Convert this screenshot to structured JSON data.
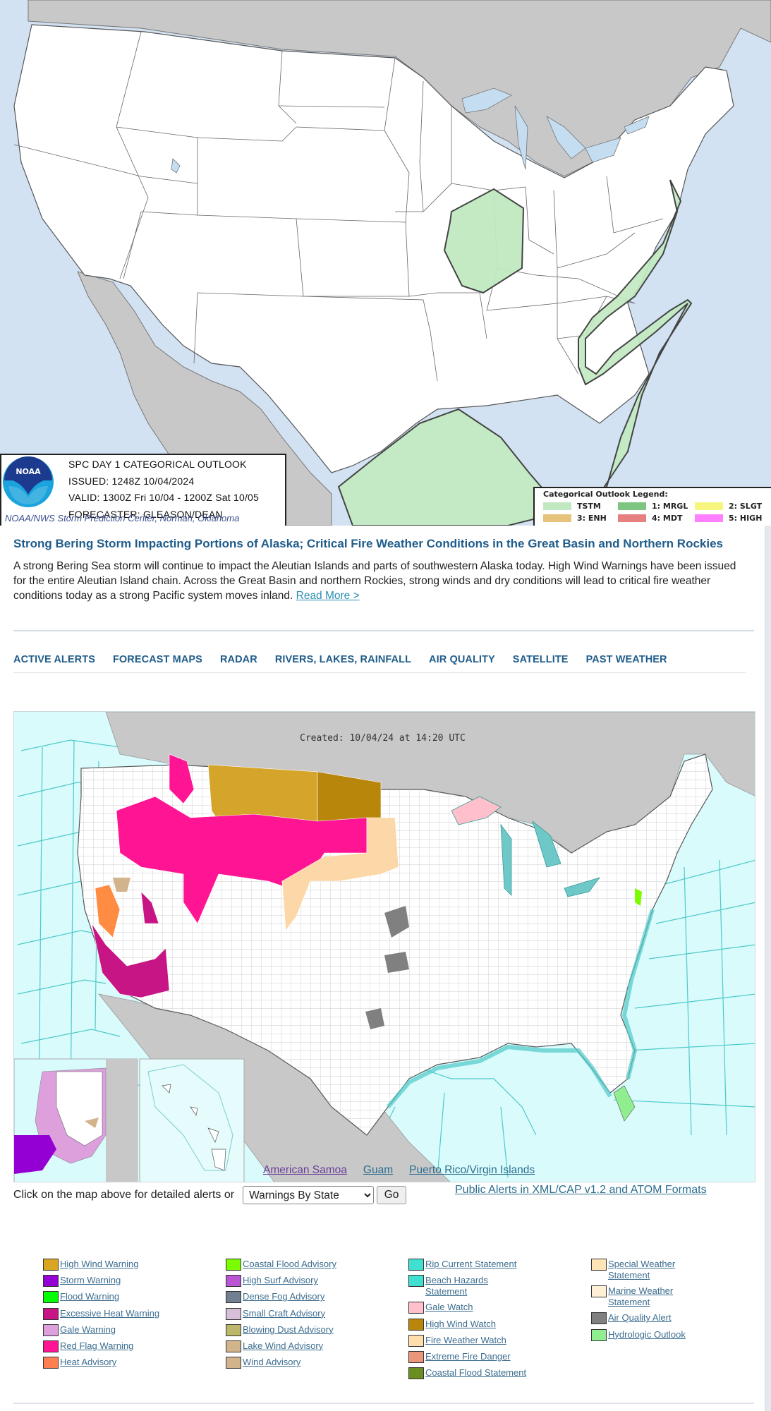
{
  "spc_outlook": {
    "title": "SPC DAY 1 CATEGORICAL OUTLOOK",
    "issued": "ISSUED: 1248Z 10/04/2024",
    "valid": "VALID: 1300Z Fri 10/04 - 1200Z Sat 10/05",
    "forecaster": "FORECASTER: GLEASON/DEAN",
    "credit": "NOAA/NWS Storm Prediction Center, Norman, Oklahoma",
    "logo_text": "NOAA",
    "legend": {
      "title": "Categorical Outlook Legend:",
      "items": [
        {
          "label": "TSTM",
          "color": "#c1e9c1"
        },
        {
          "label": "1: MRGL",
          "color": "#7dc580"
        },
        {
          "label": "2: SLGT",
          "color": "#f6f67f"
        },
        {
          "label": "3: ENH",
          "color": "#e6c27a"
        },
        {
          "label": "4: MDT",
          "color": "#e67f7f"
        },
        {
          "label": "5: HIGH",
          "color": "#ff7fff"
        }
      ]
    },
    "active_category": "TSTM"
  },
  "headline": {
    "title": "Strong Bering Storm Impacting Portions of Alaska; Critical Fire Weather Conditions in the Great Basin and Northern Rockies",
    "body": "A strong Bering Sea storm will continue to impact the Aleutian Islands and parts of southwestern Alaska today. High Wind Warnings have been issued for the entire Aleutian Island chain. Across the Great Basin and northern Rockies, strong winds and dry conditions will lead to critical fire weather conditions today as a strong Pacific system moves inland.",
    "read_more": "Read More >"
  },
  "nav": {
    "items": [
      "ACTIVE ALERTS",
      "FORECAST MAPS",
      "RADAR",
      "RIVERS, LAKES, RAINFALL",
      "AIR QUALITY",
      "SATELLITE",
      "PAST WEATHER"
    ]
  },
  "alert_map": {
    "created": "Created: 10/04/24 at 14:20 UTC",
    "territories": [
      "American Samoa",
      "Guam",
      "Puerto Rico/Virgin Islands"
    ]
  },
  "controls": {
    "prompt": "Click on the map above for detailed alerts or",
    "select_value": "Warnings By State",
    "go_label": "Go",
    "cap_link": "Public Alerts in XML/CAP v1.2 and ATOM Formats"
  },
  "legend": {
    "columns": [
      [
        {
          "label": "High Wind Warning",
          "color": "#daa520"
        },
        {
          "label": "Storm Warning",
          "color": "#9400d3"
        },
        {
          "label": "Flood Warning",
          "color": "#00ff00"
        },
        {
          "label": "Excessive Heat Warning",
          "color": "#c71585"
        },
        {
          "label": "Gale Warning",
          "color": "#dda0dd"
        },
        {
          "label": "Red Flag Warning",
          "color": "#ff1493"
        },
        {
          "label": "Heat Advisory",
          "color": "#ff7f50"
        }
      ],
      [
        {
          "label": "Coastal Flood Advisory",
          "color": "#7cfc00"
        },
        {
          "label": "High Surf Advisory",
          "color": "#ba55d3"
        },
        {
          "label": "Dense Fog Advisory",
          "color": "#708090"
        },
        {
          "label": "Small Craft Advisory",
          "color": "#d8bfd8"
        },
        {
          "label": "Blowing Dust Advisory",
          "color": "#bdb76b"
        },
        {
          "label": "Lake Wind Advisory",
          "color": "#d2b48c"
        },
        {
          "label": "Wind Advisory",
          "color": "#d2b48c"
        }
      ],
      [
        {
          "label": "Rip Current Statement",
          "color": "#40e0d0"
        },
        {
          "label": "Beach Hazards Statement",
          "color": "#40e0d0"
        },
        {
          "label": "Gale Watch",
          "color": "#ffc0cb"
        },
        {
          "label": "High Wind Watch",
          "color": "#b8860b"
        },
        {
          "label": "Fire Weather Watch",
          "color": "#ffdead"
        },
        {
          "label": "Extreme Fire Danger",
          "color": "#e9967a"
        },
        {
          "label": "Coastal Flood Statement",
          "color": "#6b8e23"
        }
      ],
      [
        {
          "label": "Special Weather Statement",
          "color": "#ffe4b5"
        },
        {
          "label": "Marine Weather Statement",
          "color": "#ffefd5"
        },
        {
          "label": "Air Quality Alert",
          "color": "#808080"
        },
        {
          "label": "Hydrologic Outlook",
          "color": "#90ee90"
        }
      ]
    ]
  }
}
